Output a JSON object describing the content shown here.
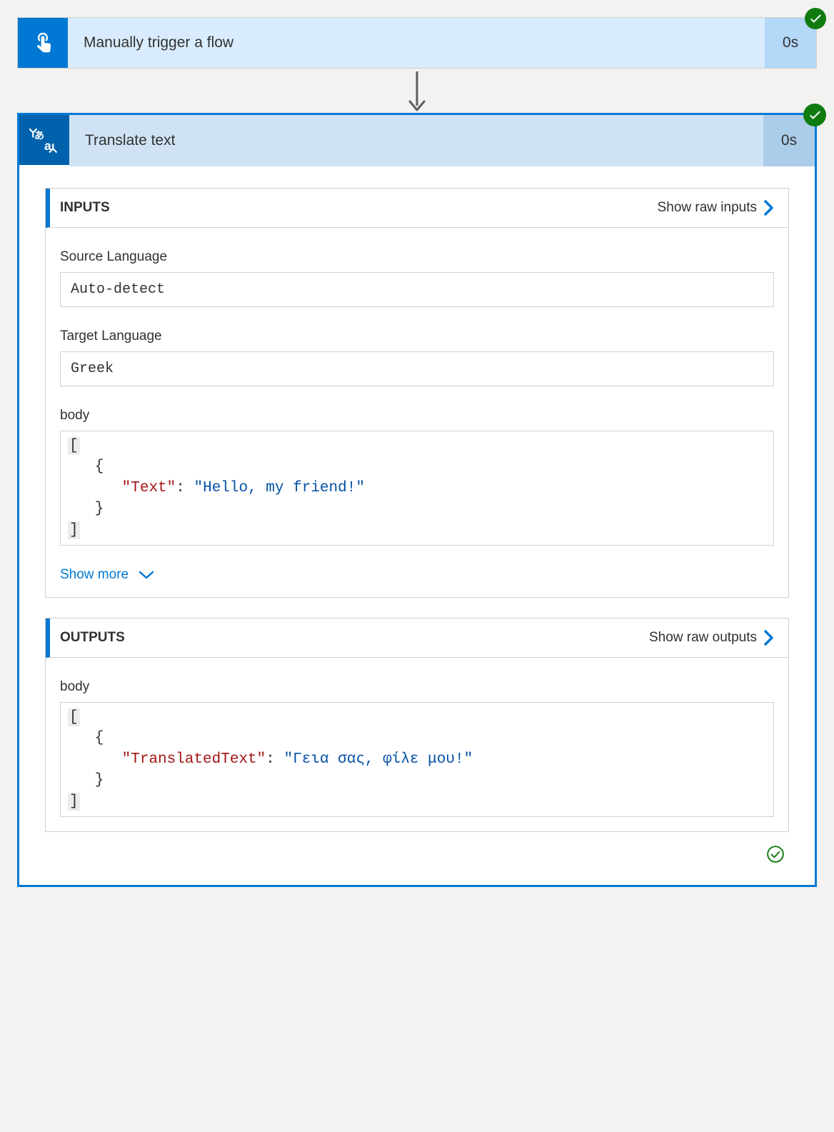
{
  "trigger": {
    "title": "Manually trigger a flow",
    "duration": "0s",
    "icon": "touch-icon",
    "status": "success"
  },
  "action": {
    "title": "Translate text",
    "duration": "0s",
    "icon": "translate-icon",
    "status": "success",
    "inputs": {
      "section_title": "INPUTS",
      "show_raw_label": "Show raw inputs",
      "fields": [
        {
          "label": "Source Language",
          "value": "Auto-detect"
        },
        {
          "label": "Target Language",
          "value": "Greek"
        }
      ],
      "body_label": "body",
      "body_json": {
        "key": "Text",
        "value": "Hello, my friend!"
      },
      "show_more_label": "Show more"
    },
    "outputs": {
      "section_title": "OUTPUTS",
      "show_raw_label": "Show raw outputs",
      "body_label": "body",
      "body_json": {
        "key": "TranslatedText",
        "value": "Γεια σας, φίλε μου!"
      }
    },
    "footer_status": "success"
  }
}
